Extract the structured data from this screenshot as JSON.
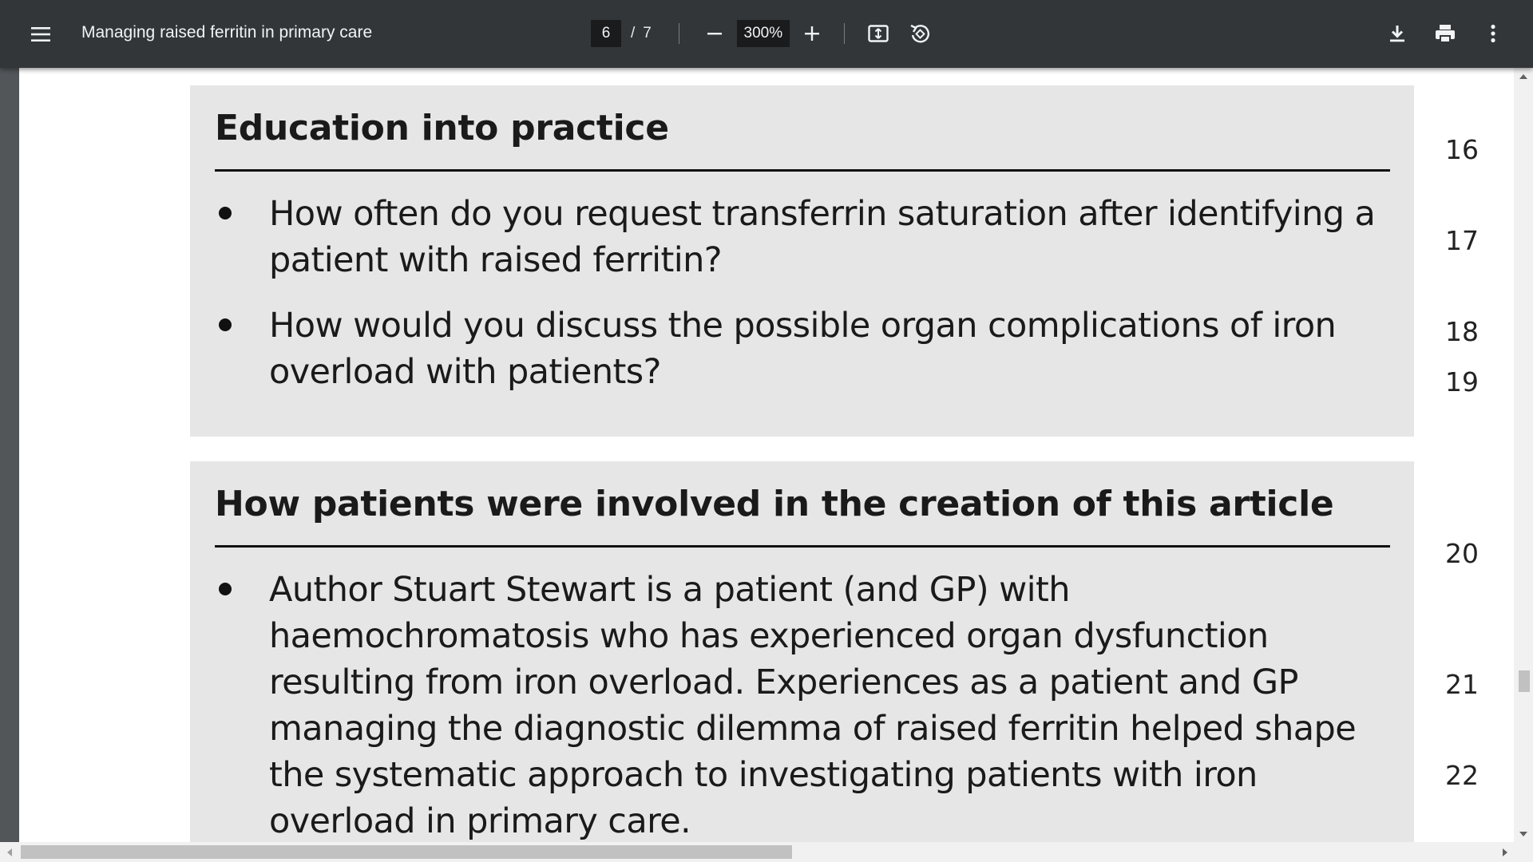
{
  "toolbar": {
    "title": "Managing raised ferritin in primary care",
    "current_page": "6",
    "page_separator": "/",
    "total_pages": "7",
    "zoom": "300%",
    "icons": {
      "menu": "hamburger-menu-icon",
      "zoom_out": "minus-icon",
      "zoom_in": "plus-icon",
      "fit": "fit-to-page-icon",
      "rotate": "rotate-counterclockwise-icon",
      "download": "download-icon",
      "print": "print-icon",
      "more": "more-vertical-icon"
    }
  },
  "document": {
    "sections": [
      {
        "heading": "Education into practice",
        "bullets": [
          "How often do you request transferrin saturation after identifying a patient with raised ferritin?",
          "How would you discuss the possible organ complications of iron overload with patients?"
        ]
      },
      {
        "heading": "How patients were involved in the creation of this article",
        "bullets": [
          "Author Stuart Stewart is a patient (and GP) with haemochromatosis who has experienced organ dysfunction resulting from iron overload. Experiences as a patient and GP managing the diagnostic dilemma of raised ferritin helped shape the systematic approach to investigating patients with iron overload in primary care."
        ]
      }
    ],
    "line_numbers": [
      "16",
      "17",
      "18",
      "19",
      "20",
      "21",
      "22"
    ]
  },
  "colors": {
    "toolbar_bg": "#323639",
    "viewer_bg": "#525659",
    "box_bg": "#e6e6e6"
  }
}
